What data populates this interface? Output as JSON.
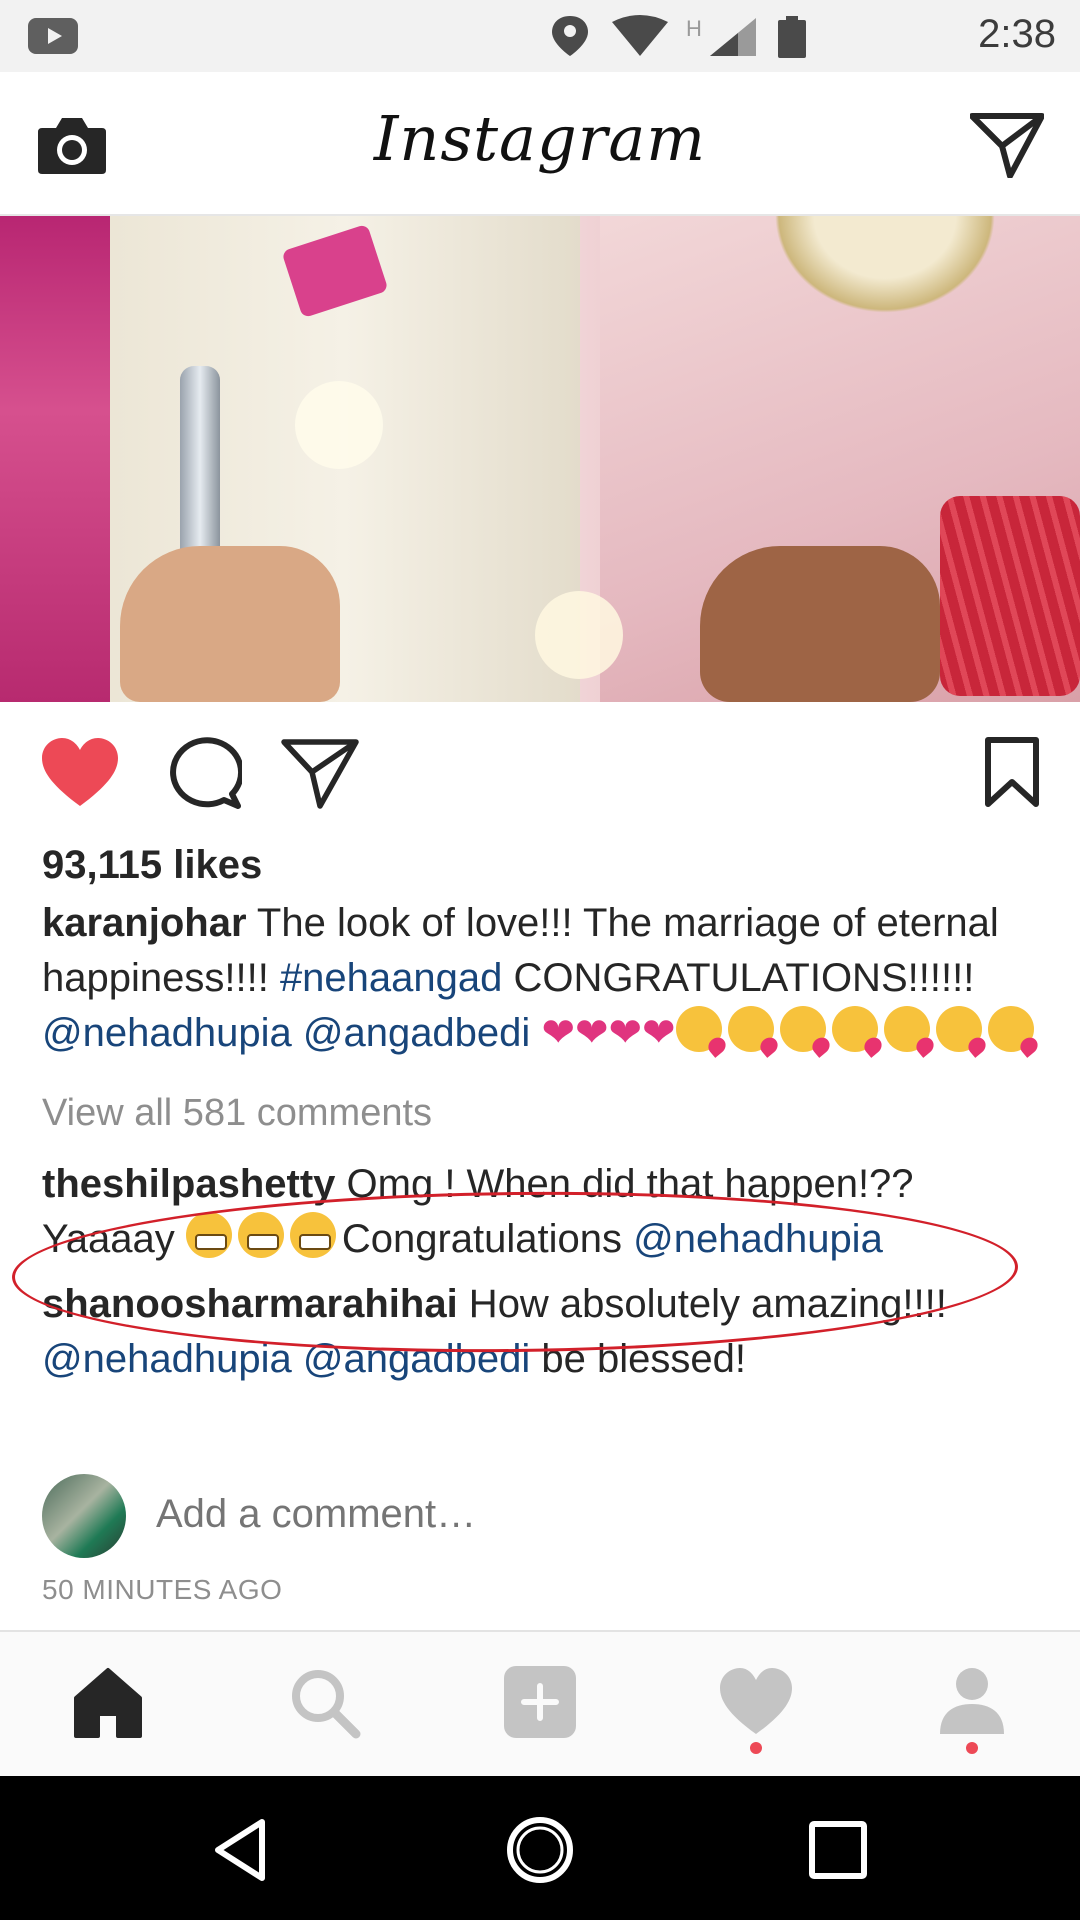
{
  "status_bar": {
    "time": "2:38",
    "network_label": "H",
    "icons": [
      "youtube-icon",
      "location-icon",
      "wifi-icon",
      "signal-icon",
      "battery-icon"
    ]
  },
  "header": {
    "logo": "Instagram",
    "icons": [
      "camera-icon",
      "direct-message-icon"
    ]
  },
  "post": {
    "liked": true,
    "like_color": "#ed4956",
    "likes": "93,115 likes",
    "caption": {
      "username": "karanjohar",
      "text_1": " The look of love!!! The marriage of eternal happiness!!!! ",
      "hashtag": "#nehaangad",
      "text_2": " CONGRATULATIONS!!!!!! ",
      "mention_1": "@nehadhupia",
      "mention_2": "@angadbedi",
      "heart_emoji_count": 4,
      "kiss_emoji_count": 7
    },
    "view_all_comments": "View all 581 comments",
    "comments": [
      {
        "username": "theshilpashetty",
        "text_1": " Omg ! When did that happen!?? Yaaaay ",
        "text_2": "Congratulations ",
        "mention": "@nehadhupia",
        "grimace_emoji_count": 3,
        "highlighted": true
      },
      {
        "username": "shanoosharmarahihai",
        "text_1": " How absolutely amazing!!!! ",
        "mention_1": "@nehadhupia",
        "mention_2": "@angadbedi",
        "text_2": " be blessed!"
      }
    ],
    "add_comment_placeholder": "Add a comment…",
    "timestamp": "50 MINUTES AGO"
  },
  "tab_bar": {
    "tabs": [
      "home-icon",
      "search-icon",
      "add-post-icon",
      "activity-heart-icon",
      "profile-icon"
    ],
    "active": "home-icon",
    "notification_dot_color": "#ed4956"
  },
  "colors": {
    "link": "#18457a",
    "highlight_ring": "#d2202a"
  }
}
